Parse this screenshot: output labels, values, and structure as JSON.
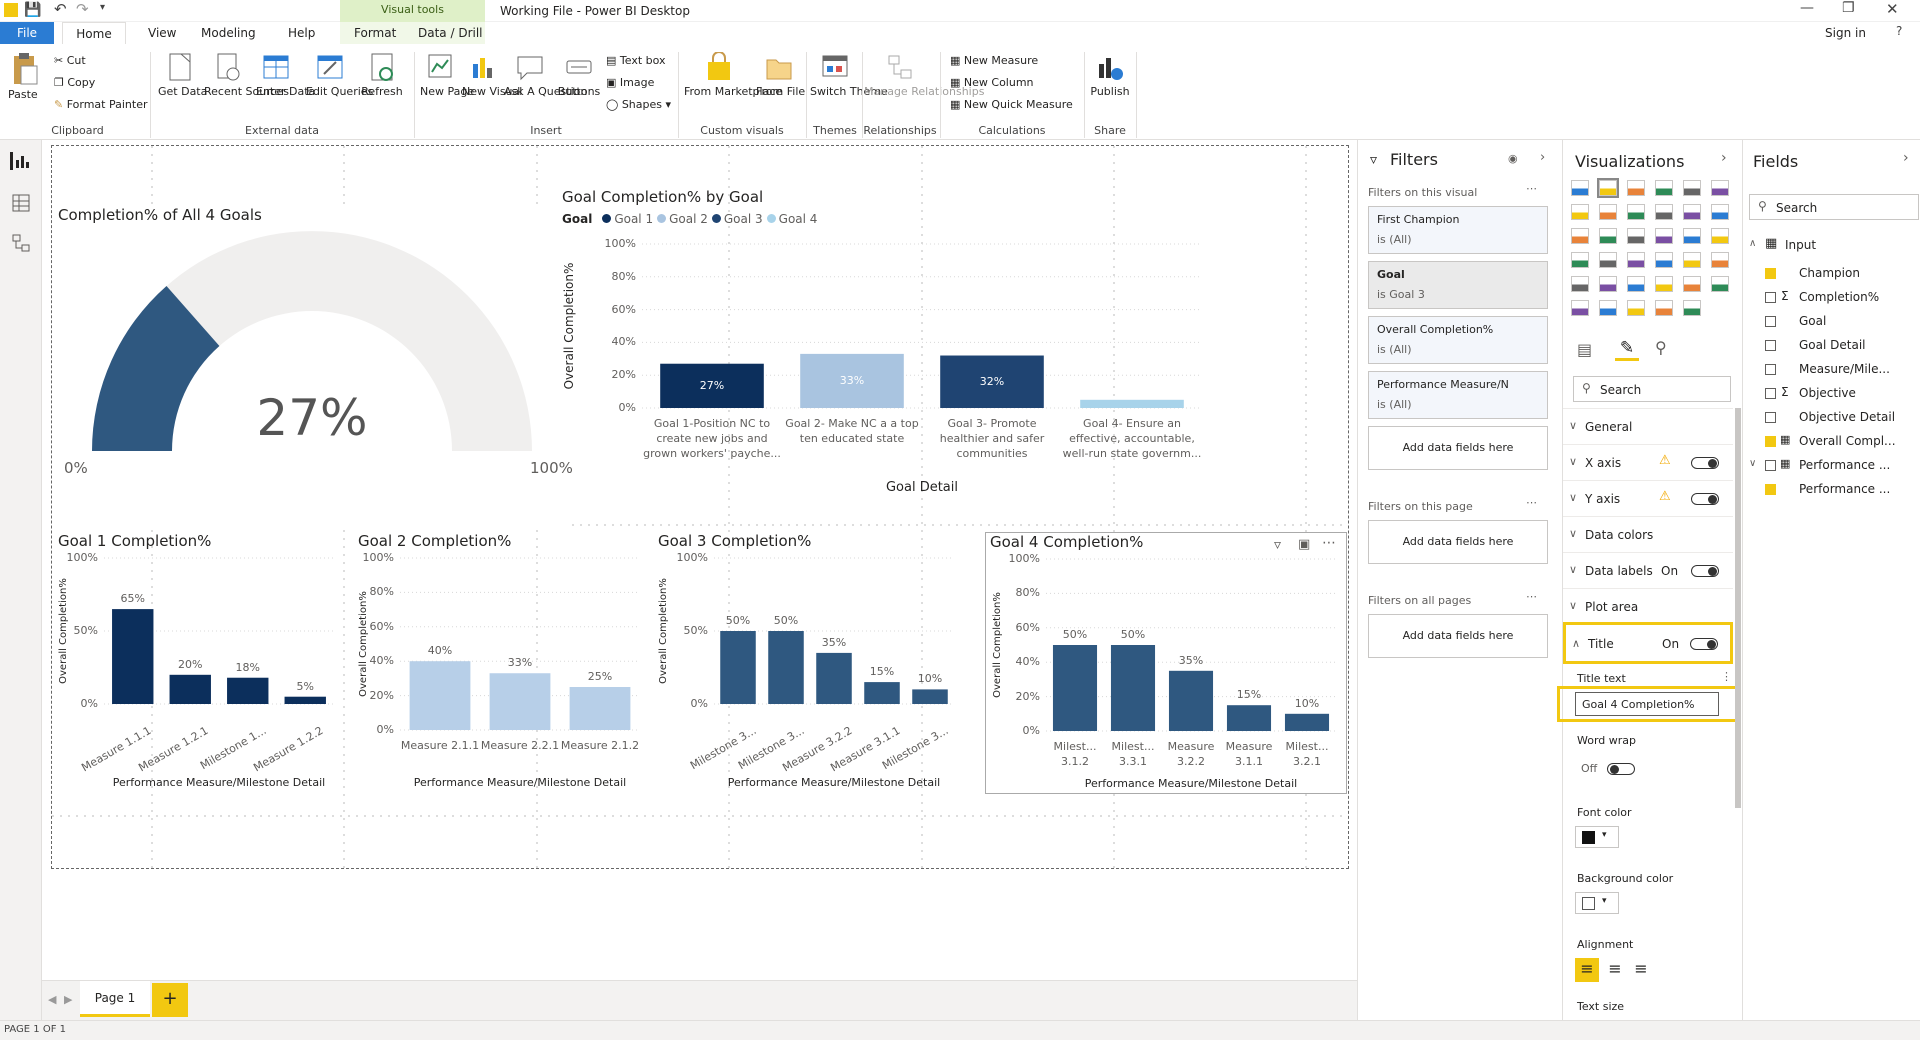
{
  "window": {
    "title": "Working File - Power BI Desktop",
    "sign_in": "Sign in",
    "contextual_group": "Visual tools"
  },
  "menu": {
    "file": "File",
    "home": "Home",
    "view": "View",
    "modeling": "Modeling",
    "help": "Help",
    "format": "Format",
    "data_drill": "Data / Drill"
  },
  "ribbon": {
    "paste": "Paste",
    "cut": "Cut",
    "copy": "Copy",
    "format_painter": "Format Painter",
    "clipboard": "Clipboard",
    "get_data": "Get Data",
    "recent_sources": "Recent Sources",
    "enter_data": "Enter Data",
    "edit_queries": "Edit Queries",
    "refresh": "Refresh",
    "external_data": "External data",
    "new_page": "New Page",
    "new_visual": "New Visual",
    "ask_question": "Ask A Question",
    "buttons": "Buttons",
    "text_box": "Text box",
    "image": "Image",
    "shapes": "Shapes",
    "insert": "Insert",
    "from_marketplace": "From Marketplace",
    "from_file": "From File",
    "custom_visuals": "Custom visuals",
    "switch_theme": "Switch Theme",
    "themes": "Themes",
    "manage_relationships": "Manage Relationships",
    "relationships": "Relationships",
    "new_measure": "New Measure",
    "new_column": "New Column",
    "new_quick_measure": "New Quick Measure",
    "calculations": "Calculations",
    "publish": "Publish",
    "share": "Share"
  },
  "gauge": {
    "title": "Completion% of All 4 Goals",
    "value_label": "27%",
    "value": 27,
    "min_label": "0%",
    "max_label": "100%",
    "color": "#2f5880"
  },
  "chart_data": [
    {
      "type": "bar",
      "title": "Goal Completion% by Goal",
      "legend_title": "Goal",
      "legend": [
        "Goal 1",
        "Goal 2",
        "Goal 3",
        "Goal 4"
      ],
      "categories": [
        "Goal 1-Position NC to create new jobs and grown workers' payche...",
        "Goal 2- Make NC a a top ten educated state",
        "Goal 3- Promote healthier and safer communities",
        "Goal 4- Ensure an effective, accountable, well-run state governm..."
      ],
      "values": [
        27,
        33,
        32,
        5
      ],
      "data_labels": [
        "27%",
        "33%",
        "32%",
        ""
      ],
      "colors": [
        "#0c2f5c",
        "#a9c4e0",
        "#1f4472",
        "#a8d3ea"
      ],
      "xlabel": "Goal Detail",
      "ylabel": "Overall Completion%",
      "yticks": [
        "100%",
        "80%",
        "60%",
        "40%",
        "20%",
        "0%"
      ],
      "ylim": [
        0,
        100
      ]
    },
    {
      "type": "bar",
      "title": "Goal 1 Completion%",
      "categories": [
        "Measure 1.1.1",
        "Measure 1.2.1",
        "Milestone 1...",
        "Measure 1.2.2"
      ],
      "values": [
        65,
        20,
        18,
        5
      ],
      "data_labels": [
        "65%",
        "20%",
        "18%",
        "5%"
      ],
      "color": "#0c2f5c",
      "xlabel": "Performance Measure/Milestone Detail",
      "ylabel": "Overall Completion%",
      "yticks": [
        "100%",
        "50%",
        "0%"
      ],
      "ylim": [
        0,
        100
      ]
    },
    {
      "type": "bar",
      "title": "Goal 2 Completion%",
      "categories": [
        "Measure 2.1.1",
        "Measure 2.2.1",
        "Measure 2.1.2"
      ],
      "values": [
        40,
        33,
        25
      ],
      "data_labels": [
        "40%",
        "33%",
        "25%"
      ],
      "color": "#b7cfe8",
      "xlabel": "Performance Measure/Milestone Detail",
      "ylabel": "Overall Completion%",
      "yticks": [
        "100%",
        "80%",
        "60%",
        "40%",
        "20%",
        "0%"
      ],
      "ylim": [
        0,
        100
      ]
    },
    {
      "type": "bar",
      "title": "Goal 3 Completion%",
      "categories": [
        "Milestone 3...",
        "Milestone 3...",
        "Measure 3.2.2",
        "Measure 3.1.1",
        "Milestone 3..."
      ],
      "values": [
        50,
        50,
        35,
        15,
        10
      ],
      "data_labels": [
        "50%",
        "50%",
        "35%",
        "15%",
        "10%"
      ],
      "color": "#2f5880",
      "xlabel": "Performance Measure/Milestone Detail",
      "ylabel": "Overall Completion%",
      "yticks": [
        "100%",
        "50%",
        "0%"
      ],
      "ylim": [
        0,
        100
      ]
    },
    {
      "type": "bar",
      "title": "Goal 4 Completion%",
      "categories": [
        "Milest... 3.1.2",
        "Milest... 3.3.1",
        "Measure 3.2.2",
        "Measure 3.1.1",
        "Milest... 3.2.1"
      ],
      "values": [
        50,
        50,
        35,
        15,
        10
      ],
      "data_labels": [
        "50%",
        "50%",
        "35%",
        "15%",
        "10%"
      ],
      "color": "#2f5880",
      "xlabel": "Performance Measure/Milestone Detail",
      "ylabel": "Overall Completion%",
      "yticks": [
        "100%",
        "80%",
        "60%",
        "40%",
        "20%",
        "0%"
      ],
      "ylim": [
        0,
        100
      ]
    }
  ],
  "filters": {
    "title": "Filters",
    "on_visual": "Filters on this visual",
    "cards": [
      {
        "name": "First Champion",
        "value": "is (All)"
      },
      {
        "name": "Goal",
        "value": "is Goal 3"
      },
      {
        "name": "Overall Completion%",
        "value": "is (All)"
      },
      {
        "name": "Performance Measure/N",
        "value": "is (All)"
      }
    ],
    "add_fields": "Add data fields here",
    "on_page": "Filters on this page",
    "on_all_pages": "Filters on all pages"
  },
  "visualizations": {
    "title": "Visualizations",
    "search_placeholder": "Search",
    "sections": {
      "general": "General",
      "x_axis": "X axis",
      "y_axis": "Y axis",
      "data_colors": "Data colors",
      "data_labels": "Data labels",
      "data_labels_state": "On",
      "plot_area": "Plot area",
      "title": "Title",
      "title_state": "On"
    },
    "title_text_label": "Title text",
    "title_text_value": "Goal 4 Completion%",
    "word_wrap": "Word wrap",
    "word_wrap_state": "Off",
    "font_color": "Font color",
    "background_color": "Background color",
    "alignment": "Alignment",
    "text_size": "Text size"
  },
  "fields": {
    "title": "Fields",
    "search_placeholder": "Search",
    "table": "Input",
    "items": [
      {
        "label": "Champion",
        "checked": true,
        "sigma": false
      },
      {
        "label": "Completion%",
        "checked": false,
        "sigma": true
      },
      {
        "label": "Goal",
        "checked": false,
        "sigma": false
      },
      {
        "label": "Goal Detail",
        "checked": false,
        "sigma": false
      },
      {
        "label": "Measure/Mile...",
        "checked": false,
        "sigma": false
      },
      {
        "label": "Objective",
        "checked": false,
        "sigma": true
      },
      {
        "label": "Objective Detail",
        "checked": false,
        "sigma": false
      },
      {
        "label": "Overall Compl...",
        "checked": true,
        "sigma": false
      },
      {
        "label": "Performance ...",
        "checked": false,
        "sigma": false
      },
      {
        "label": "Performance ...",
        "checked": true,
        "sigma": false
      }
    ]
  },
  "pages": {
    "tab": "Page 1",
    "add": "+"
  },
  "status": {
    "text": "PAGE 1 OF 1"
  }
}
